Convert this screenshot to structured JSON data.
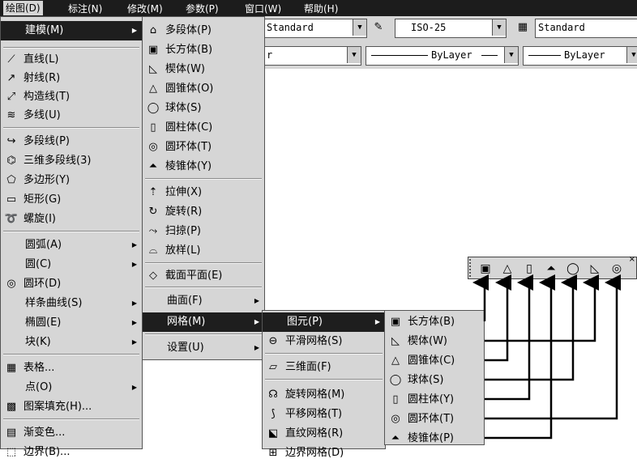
{
  "menubar": [
    "绘图(D)",
    "标注(N)",
    "修改(M)",
    "参数(P)",
    "窗口(W)",
    "帮助(H)"
  ],
  "toolbar": {
    "text_style": "Standard",
    "dim_style": "ISO-25",
    "table_style": "Standard",
    "layer_partial": "r",
    "linetype": "ByLayer",
    "lineweight": "ByLayer"
  },
  "draw_menu": [
    {
      "label": "建模(M)",
      "icon": "",
      "sub": true,
      "hl": true
    },
    {
      "label": "直线(L)",
      "icon": "line-icon"
    },
    {
      "label": "射线(R)",
      "icon": "ray-icon"
    },
    {
      "label": "构造线(T)",
      "icon": "xline-icon"
    },
    {
      "label": "多线(U)",
      "icon": "mline-icon"
    },
    {
      "label": "多段线(P)",
      "icon": "pline-icon"
    },
    {
      "label": "三维多段线(3)",
      "icon": "3dpoly-icon"
    },
    {
      "label": "多边形(Y)",
      "icon": "polygon-icon"
    },
    {
      "label": "矩形(G)",
      "icon": "rectangle-icon"
    },
    {
      "label": "螺旋(I)",
      "icon": "helix-icon"
    },
    {
      "label": "圆弧(A)",
      "sub": true
    },
    {
      "label": "圆(C)",
      "sub": true
    },
    {
      "label": "圆环(D)",
      "icon": "donut-icon"
    },
    {
      "label": "样条曲线(S)",
      "sub": true
    },
    {
      "label": "椭圆(E)",
      "sub": true
    },
    {
      "label": "块(K)",
      "sub": true
    },
    {
      "label": "表格...",
      "icon": "table-icon"
    },
    {
      "label": "点(O)",
      "sub": true
    },
    {
      "label": "图案填充(H)...",
      "icon": "hatch-icon"
    },
    {
      "label": "渐变色...",
      "icon": "gradient-icon"
    },
    {
      "label": "边界(B)...",
      "icon": "boundary-icon"
    }
  ],
  "model_menu": [
    {
      "label": "多段体(P)",
      "icon": "polysolid-icon"
    },
    {
      "label": "长方体(B)",
      "icon": "box-icon"
    },
    {
      "label": "楔体(W)",
      "icon": "wedge-icon"
    },
    {
      "label": "圆锥体(O)",
      "icon": "cone-icon"
    },
    {
      "label": "球体(S)",
      "icon": "sphere-icon"
    },
    {
      "label": "圆柱体(C)",
      "icon": "cylinder-icon"
    },
    {
      "label": "圆环体(T)",
      "icon": "torus-icon"
    },
    {
      "label": "棱锥体(Y)",
      "icon": "pyramid-icon"
    },
    {
      "label": "拉伸(X)",
      "icon": "extrude-icon"
    },
    {
      "label": "旋转(R)",
      "icon": "revolve-icon"
    },
    {
      "label": "扫掠(P)",
      "icon": "sweep-icon"
    },
    {
      "label": "放样(L)",
      "icon": "loft-icon"
    },
    {
      "label": "截面平面(E)",
      "icon": "section-plane-icon"
    },
    {
      "label": "曲面(F)",
      "sub": true
    },
    {
      "label": "网格(M)",
      "sub": true,
      "hl": true
    },
    {
      "label": "设置(U)",
      "sub": true
    }
  ],
  "mesh_menu": [
    {
      "label": "图元(P)",
      "sub": true,
      "hl": true
    },
    {
      "label": "平滑网格(S)",
      "icon": "smooth-mesh-icon"
    },
    {
      "label": "三维面(F)",
      "icon": "3dface-icon"
    },
    {
      "label": "旋转网格(M)",
      "icon": "revsurf-icon"
    },
    {
      "label": "平移网格(T)",
      "icon": "tabsurf-icon"
    },
    {
      "label": "直纹网格(R)",
      "icon": "rulesurf-icon"
    },
    {
      "label": "边界网格(D)",
      "icon": "edgesurf-icon"
    }
  ],
  "primitive_menu": [
    {
      "label": "长方体(B)",
      "icon": "box-icon"
    },
    {
      "label": "楔体(W)",
      "icon": "wedge-icon"
    },
    {
      "label": "圆锥体(C)",
      "icon": "cone-icon"
    },
    {
      "label": "球体(S)",
      "icon": "sphere-icon"
    },
    {
      "label": "圆柱体(Y)",
      "icon": "cylinder-icon"
    },
    {
      "label": "圆环体(T)",
      "icon": "torus-icon"
    },
    {
      "label": "棱锥体(P)",
      "icon": "pyramid-icon"
    }
  ],
  "float_toolbar": [
    "box-icon",
    "cone-icon",
    "cylinder-icon",
    "pyramid-icon",
    "sphere-icon",
    "wedge-icon",
    "torus-icon"
  ]
}
